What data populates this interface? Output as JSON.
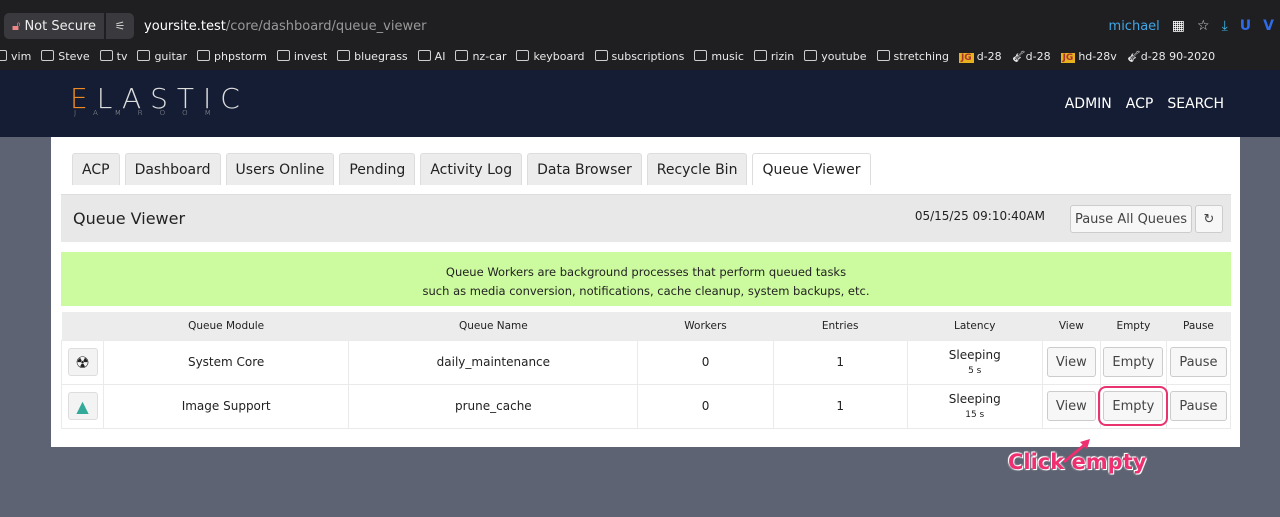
{
  "browser": {
    "security": "Not Secure",
    "url_host": "yoursite.test",
    "url_path": "/core/dashboard/queue_viewer",
    "profile": "michael",
    "bookmarks": [
      "vim",
      "Steve",
      "tv",
      "guitar",
      "phpstorm",
      "invest",
      "bluegrass",
      "AI",
      "nz-car",
      "keyboard",
      "subscriptions",
      "music",
      "rizin",
      "youtube",
      "stretching"
    ],
    "special_bookmarks": [
      {
        "icon": "JG",
        "label": "d-28"
      },
      {
        "icon": "guitar",
        "label": "d-28"
      },
      {
        "icon": "JG",
        "label": "hd-28v"
      },
      {
        "icon": "guitar",
        "label": "d-28 90-2020"
      }
    ]
  },
  "header": {
    "logo_main": "LASTIC",
    "logo_first": "E",
    "logo_sub": "JAMROOM",
    "nav": [
      "ADMIN",
      "ACP",
      "SEARCH"
    ]
  },
  "tabs": [
    "ACP",
    "Dashboard",
    "Users Online",
    "Pending",
    "Activity Log",
    "Data Browser",
    "Recycle Bin",
    "Queue Viewer"
  ],
  "page": {
    "title": "Queue Viewer",
    "timestamp": "05/15/25 09:10:40AM",
    "pause_all": "Pause All Queues"
  },
  "notice": [
    "Queue Workers are background processes that perform queued tasks",
    "such as media conversion, notifications, cache cleanup, system backups, etc."
  ],
  "table": {
    "headers": [
      "Queue Module",
      "Queue Name",
      "Workers",
      "Entries",
      "Latency",
      "View",
      "Empty",
      "Pause"
    ],
    "rows": [
      {
        "icon": "radiation",
        "module": "System Core",
        "name": "daily_maintenance",
        "workers": "0",
        "entries": "1",
        "status": "Sleeping",
        "latency": "5 s",
        "view": "View",
        "empty": "Empty",
        "pause": "Pause"
      },
      {
        "icon": "image",
        "module": "Image Support",
        "name": "prune_cache",
        "workers": "0",
        "entries": "1",
        "status": "Sleeping",
        "latency": "15 s",
        "view": "View",
        "empty": "Empty",
        "pause": "Pause"
      }
    ]
  },
  "annotation": {
    "text": "Click empty",
    "color": "#ee2f70"
  }
}
